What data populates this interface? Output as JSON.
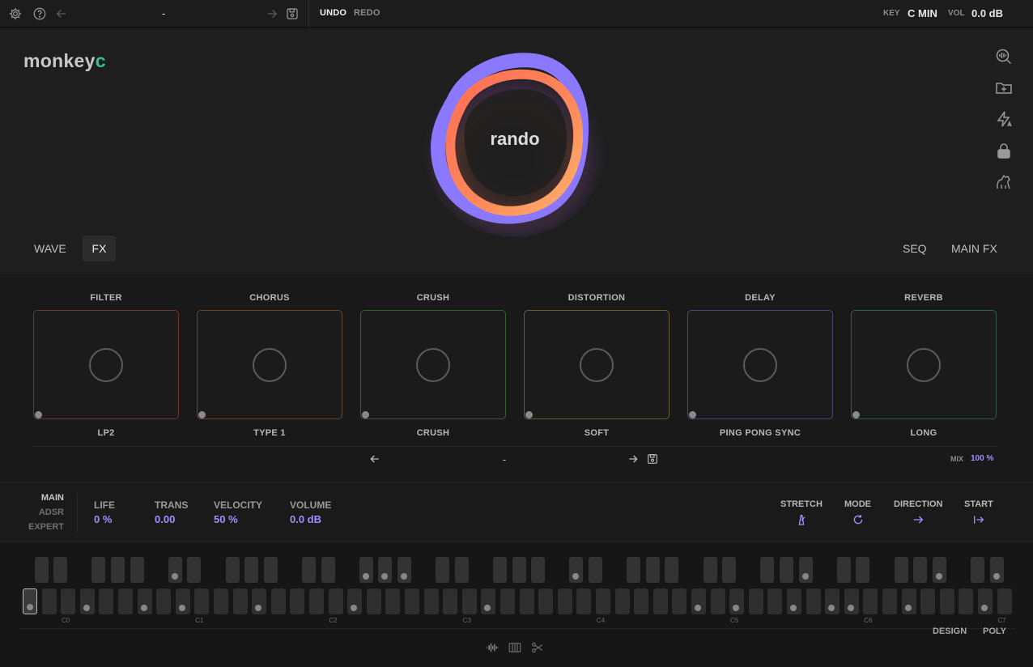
{
  "topbar": {
    "preset_name": "-",
    "undo": "UNDO",
    "redo": "REDO",
    "key_label": "KEY",
    "key_value": "C MIN",
    "vol_label": "VOL",
    "vol_value": "0.0 dB"
  },
  "brand": {
    "logo_main": "monkey",
    "logo_accent": "c"
  },
  "visualizer": {
    "name": "rando"
  },
  "tabs_left": [
    {
      "label": "WAVE",
      "active": false
    },
    {
      "label": "FX",
      "active": true
    }
  ],
  "tabs_right": [
    {
      "label": "SEQ"
    },
    {
      "label": "MAIN FX"
    }
  ],
  "fx": [
    {
      "title": "FILTER",
      "sub": "LP2",
      "color": "#7a3b30"
    },
    {
      "title": "CHORUS",
      "sub": "TYPE 1",
      "color": "#7a4a28"
    },
    {
      "title": "CRUSH",
      "sub": "CRUSH",
      "color": "#3b6a33"
    },
    {
      "title": "DISTORTION",
      "sub": "SOFT",
      "color": "#7a6a2c"
    },
    {
      "title": "DELAY",
      "sub": "PING PONG SYNC",
      "color": "#5a4a86"
    },
    {
      "title": "REVERB",
      "sub": "LONG",
      "color": "#3a6660"
    }
  ],
  "fx_preset": {
    "name": "-",
    "mix_label": "MIX",
    "mix_value": "100 %"
  },
  "modes": {
    "main": "MAIN",
    "adsr": "ADSR",
    "expert": "EXPERT"
  },
  "params": [
    {
      "label": "LIFE",
      "value": "0 %"
    },
    {
      "label": "TRANS",
      "value": "0.00"
    },
    {
      "label": "VELOCITY",
      "value": "50 %"
    },
    {
      "label": "VOLUME",
      "value": "0.0 dB"
    }
  ],
  "right_params": [
    {
      "label": "STRETCH",
      "icon": "metronome-icon"
    },
    {
      "label": "MODE",
      "icon": "loop-icon"
    },
    {
      "label": "DIRECTION",
      "icon": "arrow-right-icon"
    },
    {
      "label": "START",
      "icon": "start-icon"
    }
  ],
  "keyboard": {
    "octaves": [
      "C0",
      "C1",
      "C2",
      "C3",
      "C4",
      "C5",
      "C6",
      "C7"
    ],
    "design_label": "DESIGN",
    "poly_label": "POLY"
  },
  "colors": {
    "accent": "#a58cff",
    "brand_green": "#33c28a"
  }
}
